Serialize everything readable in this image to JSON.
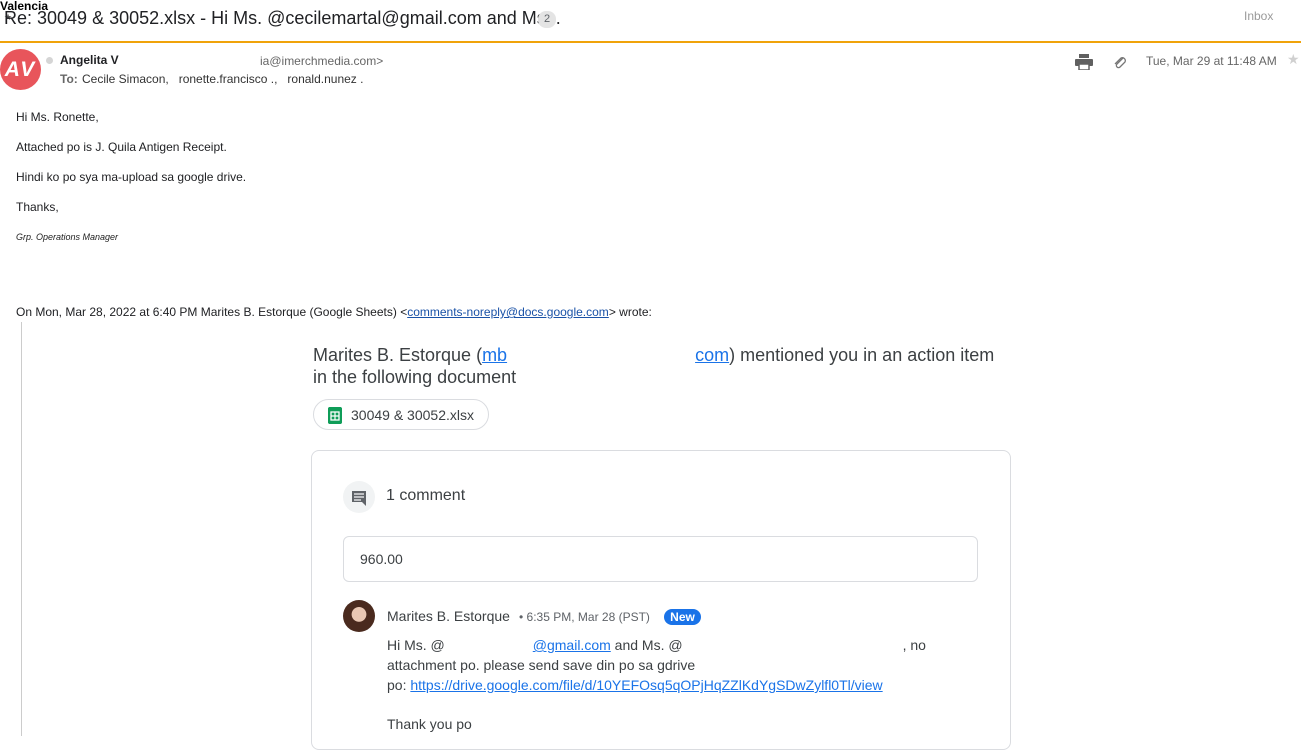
{
  "header": {
    "sender_short": "Valencia",
    "subject": "Re: 30049 & 30052.xlsx - Hi Ms. @cecilemartal@gmail.com and Ms...",
    "thread_count": "2",
    "folder_label": "Inbox"
  },
  "message": {
    "avatar_initials": "AV",
    "avatar_color": "#e8555b",
    "from_name": "Angelita V",
    "from_email": "ia@imerchmedia.com>",
    "to_label": "To:",
    "to_recipients": "Cecile Simacon,   ronette.francisco .,   ronald.nunez .",
    "date": "Tue, Mar 29 at 11:48 AM",
    "icons": [
      "print-icon",
      "paperclip-icon",
      "star-icon"
    ]
  },
  "body": {
    "greeting": "Hi Ms. Ronette,",
    "line1": "Attached po is J. Quila Antigen Receipt.",
    "line2": "Hindi ko po sya ma-upload sa google drive.",
    "thanks": "Thanks,",
    "signature_title": "Grp. Operations Manager",
    "quote_prefix": "On Mon, Mar 28, 2022 at 6:40 PM Marites B. Estorque (Google Sheets) <",
    "quote_email": "comments-noreply@docs.google.com",
    "quote_suffix": "> wrote:"
  },
  "quoted": {
    "mention_name": "Marites B. Estorque (",
    "mention_link_start": "mb",
    "mention_link_end": "com",
    "mention_rest_line1": ") mentioned you in an action item",
    "mention_line2": "in the following document",
    "file_name": "30049 & 30052.xlsx",
    "comment_count": "1 comment",
    "quoted_value": "960.00",
    "comment_author": "Marites B. Estorque",
    "comment_meta": "• 6:35 PM, Mar 28 (PST)",
    "new_badge": "New",
    "comment_hi": "Hi Ms. @",
    "comment_email_end": "@gmail.com",
    "comment_and": " and Ms. @",
    "comment_no": ", no",
    "comment_line2": "attachment po. please send save din po sa gdrive",
    "comment_po": "po: ",
    "drive_link": "https://drive.google.com/file/d/10YEFOsq5qOPjHqZZlKdYgSDwZylfl0Tl/view",
    "comment_thanks": "Thank you po"
  }
}
